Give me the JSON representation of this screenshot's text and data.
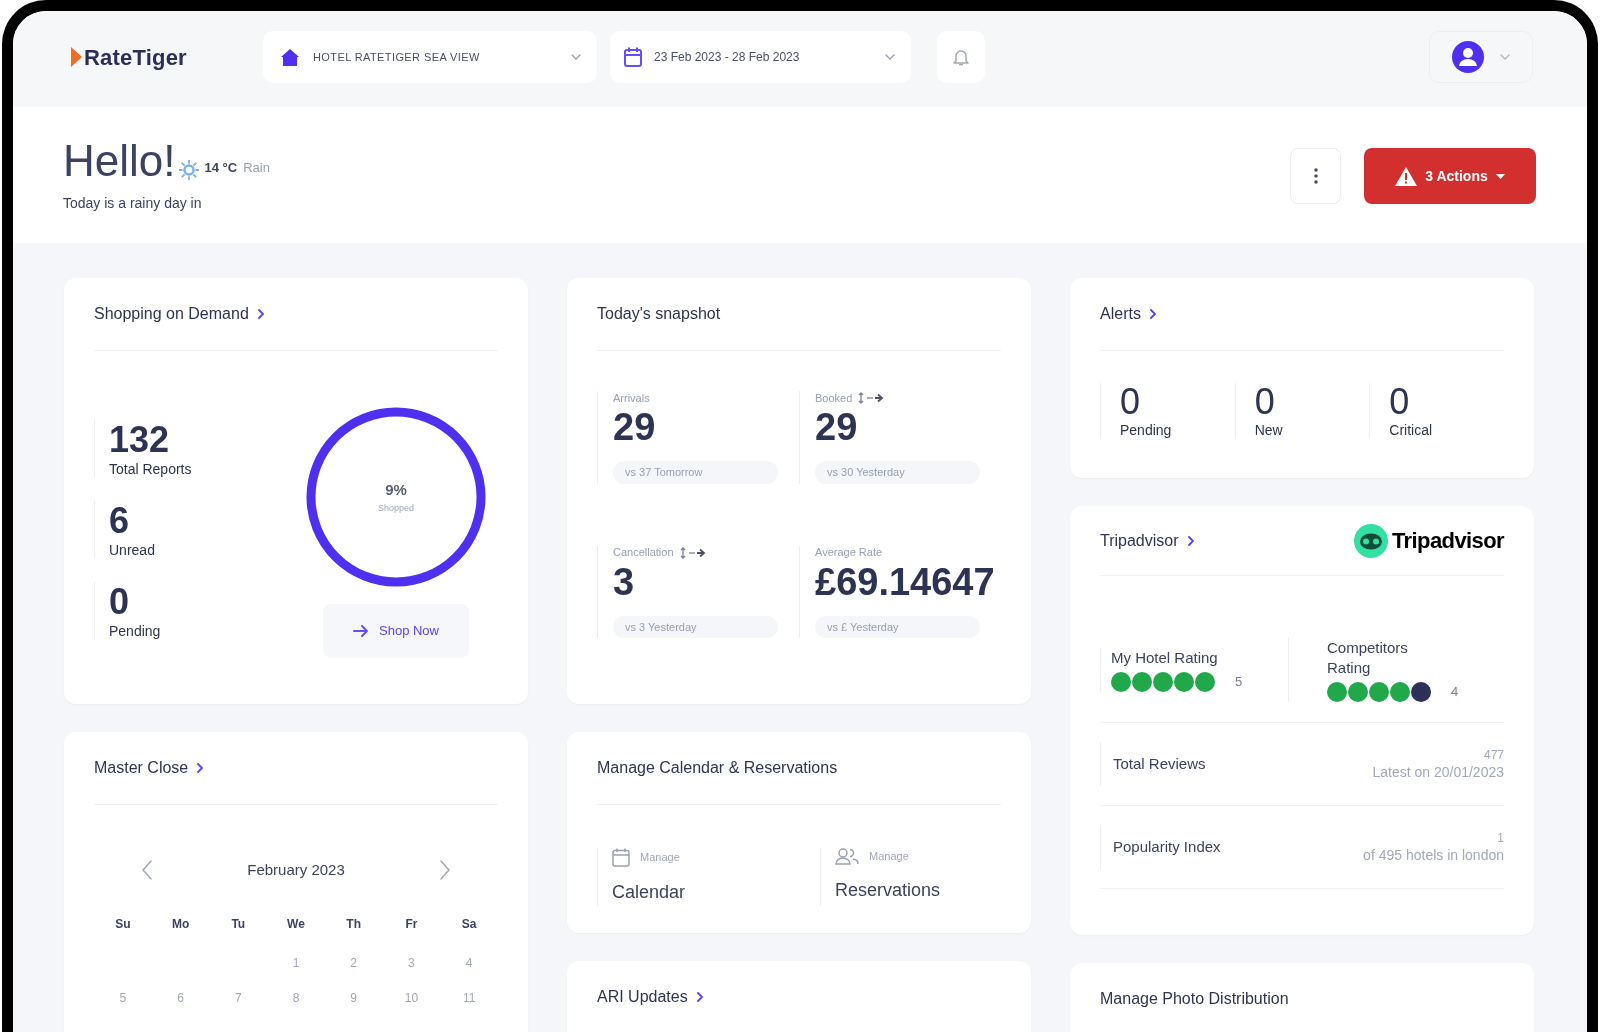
{
  "top_bar": {
    "logo": "RateTiger",
    "property": "HOTEL RATETIGER SEA VIEW",
    "date_range": "23 Feb 2023 - 28 Feb 2023"
  },
  "greeting": {
    "title": "Hello!",
    "temperature": "14 °C",
    "condition": "Rain",
    "subtitle": "Today is a rainy day in"
  },
  "actions_button": {
    "label": "3 Actions"
  },
  "shopping_on_demand": {
    "title": "Shopping on Demand",
    "link": true,
    "stats": [
      {
        "value": "132",
        "label": "Total Reports"
      },
      {
        "value": "6",
        "label": "Unread"
      },
      {
        "value": "0",
        "label": "Pending"
      }
    ],
    "ring": {
      "value": "9%",
      "caption": "Shopped"
    },
    "button": "Shop Now"
  },
  "todays_snapshot": {
    "title": "Today's snapshot",
    "link": false,
    "metrics": [
      {
        "label": "Arrivals",
        "compare_icon": false,
        "value": "29",
        "comparison": "vs 37 Tomorrow"
      },
      {
        "label": "Booked",
        "compare_icon": true,
        "value": "29",
        "comparison": "vs 30 Yesterday"
      },
      {
        "label": "Cancellation",
        "compare_icon": true,
        "value": "3",
        "comparison": "vs 3 Yesterday"
      },
      {
        "label": "Average Rate",
        "compare_icon": false,
        "value": "£69.14647",
        "comparison": "vs £ Yesterday"
      }
    ]
  },
  "alerts": {
    "title": "Alerts",
    "link": true,
    "counts": [
      {
        "value": "0",
        "label": "Pending"
      },
      {
        "value": "0",
        "label": "New"
      },
      {
        "value": "0",
        "label": "Critical"
      }
    ]
  },
  "tripadvisor": {
    "title": "Tripadvisor",
    "link": true,
    "logo": "Tripadvisor",
    "ratings": [
      {
        "label": "My Hotel Rating",
        "stars": 5,
        "score": "5"
      },
      {
        "label": "Competitors Rating",
        "stars": 4,
        "score": "4"
      }
    ],
    "details": [
      {
        "label": "Total Reviews",
        "value": "477",
        "note": "Latest on 20/01/2023"
      },
      {
        "label": "Popularity Index",
        "value": "1",
        "note": "of 495 hotels in london"
      }
    ]
  },
  "master_close": {
    "title": "Master Close",
    "link": true,
    "calendar": {
      "month": "February 2023",
      "weekdays": [
        "Su",
        "Mo",
        "Tu",
        "We",
        "Th",
        "Fr",
        "Sa"
      ],
      "weeks": [
        [
          "1",
          "2",
          "3",
          "4"
        ],
        [
          "5",
          "6",
          "7",
          "8",
          "9",
          "10",
          "11"
        ]
      ]
    }
  },
  "manage_calendar": {
    "title": "Manage Calendar & Reservations",
    "link": false,
    "items": [
      {
        "kind": "calendar",
        "caption": "Manage",
        "label": "Calendar"
      },
      {
        "kind": "reservations",
        "caption": "Manage",
        "label": "Reservations"
      }
    ]
  },
  "ari_updates": {
    "title": "ARI Updates",
    "link": true
  },
  "photo_distribution": {
    "title": "Manage Photo Distribution",
    "link": false
  }
}
